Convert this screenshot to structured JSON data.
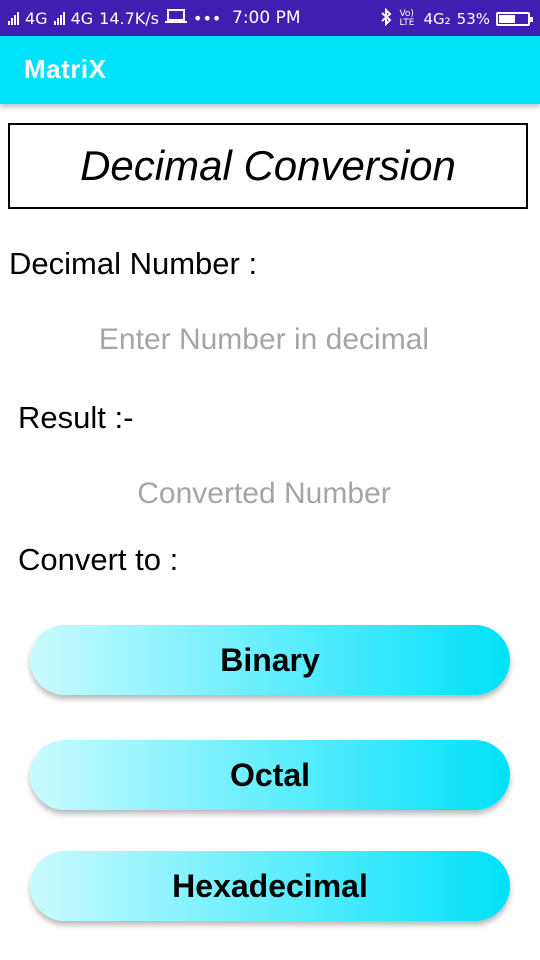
{
  "status_bar": {
    "network": "4G",
    "network2": "4G",
    "speed": "14.7K/s",
    "dots": "•••",
    "time": "7:00 PM",
    "volte": "Vo) LTE",
    "network3": "4G₂",
    "battery": "53%"
  },
  "app_bar": {
    "title": "MatriX"
  },
  "heading": "Decimal Conversion",
  "input_section": {
    "label": "Decimal Number :",
    "placeholder": "Enter Number in decimal"
  },
  "result_section": {
    "label": "Result :-",
    "placeholder": "Converted Number"
  },
  "convert_section": {
    "label": "Convert to :",
    "buttons": [
      "Binary",
      "Octal",
      "Hexadecimal"
    ]
  }
}
